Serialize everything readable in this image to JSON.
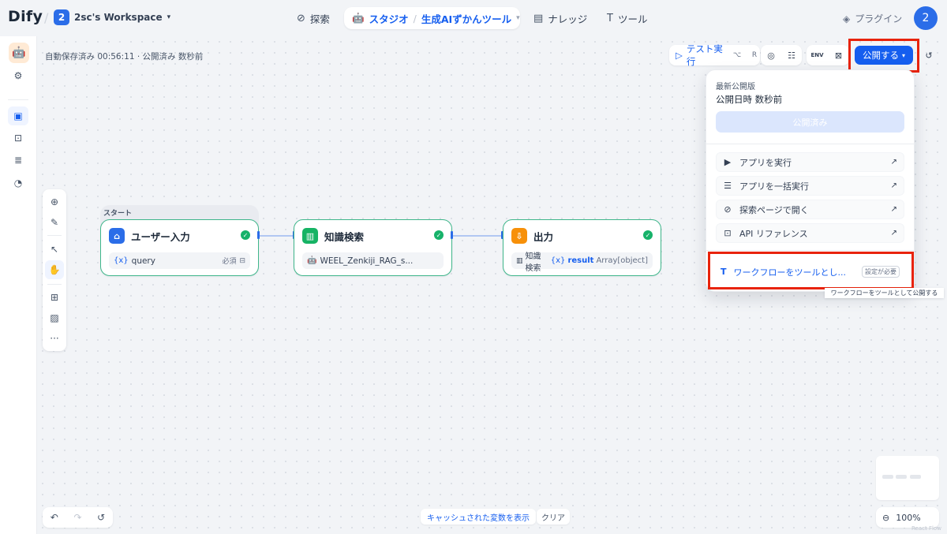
{
  "app": {
    "logo": "Dify",
    "workspace_badge": "2",
    "workspace_name": "2sc's Workspace"
  },
  "nav": {
    "explore": "探索",
    "studio": "スタジオ",
    "current_app": "生成AIずかんツール",
    "knowledge": "ナレッジ",
    "tools": "ツール",
    "plugins": "プラグイン",
    "avatar": "2"
  },
  "status": {
    "autosave": "自動保存済み 00:56:11 · 公開済み 数秒前"
  },
  "toolbar": {
    "test_run": "テスト実行",
    "shortcut_1": "⌥",
    "shortcut_2": "R",
    "env": "ENV",
    "publish": "公開する"
  },
  "nodes": {
    "start_group_label": "スタート",
    "start": {
      "title": "ユーザー入力",
      "var_prefix": "{x}",
      "var_name": "query",
      "required": "必須"
    },
    "knowledge": {
      "title": "知識検索",
      "dataset": "WEEL_Zenkiji_RAG_s..."
    },
    "output": {
      "title": "出力",
      "source": "知識検索",
      "var_prefix": "{x}",
      "var_name": "result",
      "type": "Array[object]"
    }
  },
  "publish_menu": {
    "latest_label": "最新公開版",
    "published_time": "公開日時 数秒前",
    "published_button": "公開済み",
    "items": [
      {
        "label": "アプリを実行",
        "icon": "play-icon"
      },
      {
        "label": "アプリを一括実行",
        "icon": "batch-icon"
      },
      {
        "label": "探索ページで開く",
        "icon": "compass-icon"
      },
      {
        "label": "API リファレンス",
        "icon": "terminal-icon"
      }
    ],
    "tool_publish": "ワークフローをツールとし...",
    "tool_badge": "設定が必要",
    "tooltip": "ワークフローをツールとして公開する"
  },
  "bottom": {
    "show_cache": "キャッシュされた変数を表示",
    "clear": "クリア",
    "zoom": "100%",
    "attribution": "React Flow"
  },
  "colors": {
    "accent": "#155eef",
    "success": "#17b26a",
    "highlight": "#e8230b"
  }
}
